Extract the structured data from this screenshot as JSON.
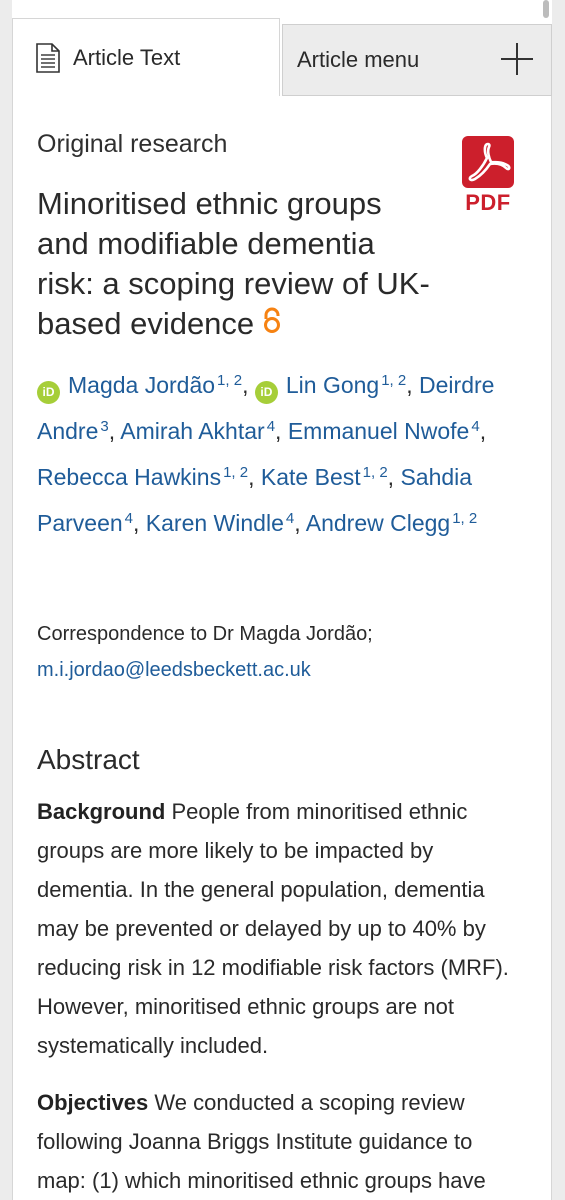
{
  "tabs": {
    "article_text": "Article Text",
    "article_menu": "Article menu"
  },
  "article": {
    "type": "Original research",
    "title": "Minoritised ethnic groups and modifiable dementia risk: a scoping review of UK-based evidence",
    "pdf_label": "PDF"
  },
  "authors": [
    {
      "name": "Magda Jordão",
      "affil": "1, 2",
      "orcid": true
    },
    {
      "name": "Lin Gong",
      "affil": "1, 2",
      "orcid": true
    },
    {
      "name": "Deirdre Andre",
      "affil": "3",
      "orcid": false
    },
    {
      "name": "Amirah Akhtar",
      "affil": "4",
      "orcid": false
    },
    {
      "name": "Emmanuel Nwofe",
      "affil": "4",
      "orcid": false
    },
    {
      "name": "Rebecca Hawkins",
      "affil": "1, 2",
      "orcid": false
    },
    {
      "name": "Kate Best",
      "affil": "1, 2",
      "orcid": false
    },
    {
      "name": "Sahdia Parveen",
      "affil": "4",
      "orcid": false
    },
    {
      "name": "Karen Windle",
      "affil": "4",
      "orcid": false
    },
    {
      "name": "Andrew Clegg",
      "affil": "1, 2",
      "orcid": false
    }
  ],
  "correspondence": {
    "label": "Correspondence to Dr Magda Jordão;",
    "email": "m.i.jordao@leedsbeckett.ac.uk"
  },
  "abstract": {
    "heading": "Abstract",
    "background_label": "Background",
    "background_text": "People from minoritised ethnic groups are more likely to be impacted by dementia. In the general population, dementia may be prevented or delayed by up to 40% by reducing risk in 12 modifiable risk factors (MRF). However, minoritised ethnic groups are not systematically included.",
    "objectives_label": "Objectives",
    "objectives_text": "We conducted a scoping review following Joanna Briggs Institute guidance to map: (1) which minoritised ethnic groups have"
  },
  "colors": {
    "link": "#1f5c99",
    "orcid": "#a6ce39",
    "pdf": "#cc1f2c",
    "open_access": "#f68212"
  }
}
